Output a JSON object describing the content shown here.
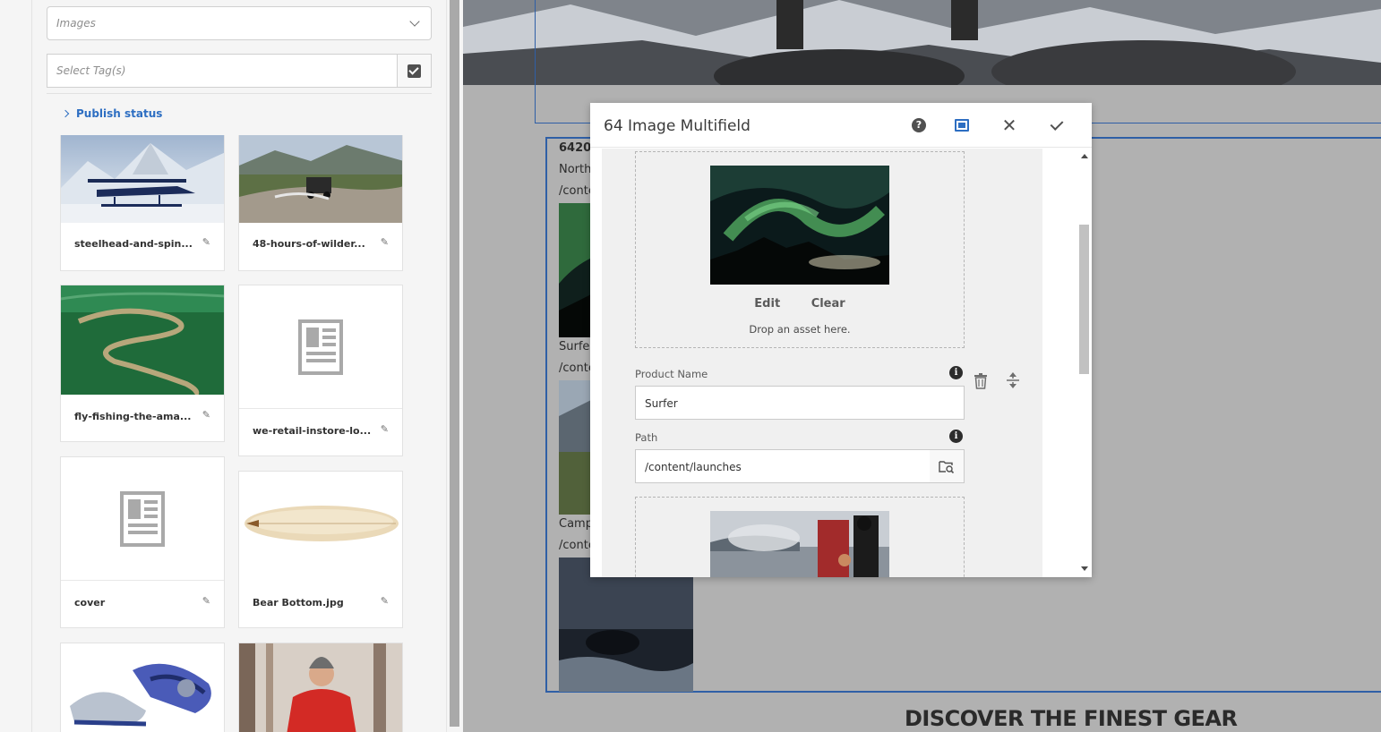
{
  "panel": {
    "asset_type": "Images",
    "tags_placeholder": "Select Tag(s)",
    "publish_status_label": "Publish status",
    "cards": [
      {
        "title": "steelhead-and-spin...",
        "thumb": "seaplane"
      },
      {
        "title": "48-hours-of-wilder...",
        "thumb": "jeep-river"
      },
      {
        "title": "fly-fishing-the-ama...",
        "thumb": "amazon-river"
      },
      {
        "title": "we-retail-instore-lo...",
        "thumb": "document-icon"
      },
      {
        "title": "cover",
        "thumb": "document-icon"
      },
      {
        "title": "Bear Bottom.jpg",
        "thumb": "surfboard"
      },
      {
        "title": "",
        "thumb": "sneakers"
      },
      {
        "title": "",
        "thumb": "man-red-jacket"
      }
    ]
  },
  "page": {
    "item_heading": "6420",
    "item1_name": "North",
    "item1_path": "/conte",
    "item2_name": "Surfer",
    "item2_path": "/conte",
    "item3_name": "Camp",
    "item3_path": "/conte",
    "section_heading": "DISCOVER THE FINEST GEAR"
  },
  "dialog": {
    "title": "64 Image Multifield",
    "edit_label": "Edit",
    "clear_label": "Clear",
    "drop_hint": "Drop an asset here.",
    "product_name_label": "Product Name",
    "product_name_value": "Surfer",
    "path_label": "Path",
    "path_value": "/content/launches",
    "info_glyph": "i",
    "help_glyph": "?"
  },
  "colors": {
    "accent": "#2d6ec2",
    "outline": "#2f5fa6",
    "canvas_bg": "#b1b1b1"
  }
}
